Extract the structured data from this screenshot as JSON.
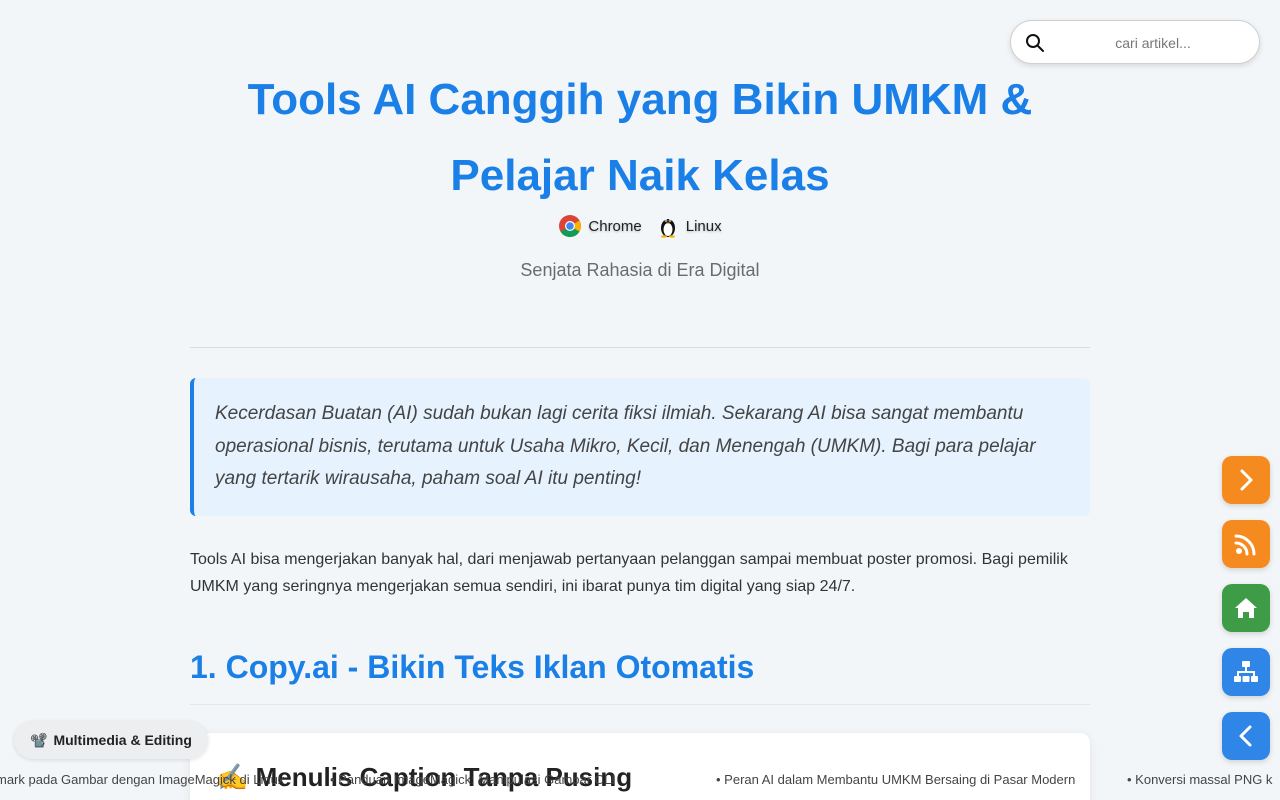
{
  "search": {
    "placeholder": "cari artikel..."
  },
  "article": {
    "title": "Tools AI Canggih yang Bikin UMKM & Pelajar Naik Kelas",
    "platforms": [
      {
        "label": "Chrome",
        "icon": "chrome-icon"
      },
      {
        "label": "Linux",
        "icon": "linux-tux-icon"
      }
    ],
    "subtitle": "Senjata Rahasia di Era Digital",
    "callout": "Kecerdasan Buatan (AI) sudah bukan lagi cerita fiksi ilmiah. Sekarang AI bisa sangat membantu operasional bisnis, terutama untuk Usaha Mikro, Kecil, dan Menengah (UMKM). Bagi para pelajar yang tertarik wirausaha, paham soal AI itu penting!",
    "intro": "Tools AI bisa mengerjakan banyak hal, dari menjawab pertanyaan pelanggan sampai membuat poster promosi. Bagi pemilik UMKM yang seringnya mengerjakan semua sendiri, ini ibarat punya tim digital yang siap 24/7.",
    "section_heading": "1. Copy.ai - Bikin Teks Iklan Otomatis",
    "card_title": "✍️ Menulis Caption Tanpa Pusing"
  },
  "category_pill": {
    "icon": "📽️",
    "label": "Multimedia & Editing"
  },
  "ticker": {
    "items": [
      "mark pada Gambar dengan ImageMagick di Linux",
      "• Panduan ImageMagick: Manipulasi Gambar CLI",
      "• Peran AI dalam Membantu UMKM Bersaing di Pasar Modern",
      "• Konversi massal PNG k"
    ]
  },
  "side_nav": [
    "next-article",
    "rss-feed",
    "home",
    "sitemap",
    "previous-article"
  ],
  "colors": {
    "accent": "#1a7fe6",
    "orange": "#f58a1f",
    "green": "#3e9c47",
    "blue": "#2f86e6",
    "background": "#f3f6f8",
    "callout_bg": "#e6f2fd"
  }
}
